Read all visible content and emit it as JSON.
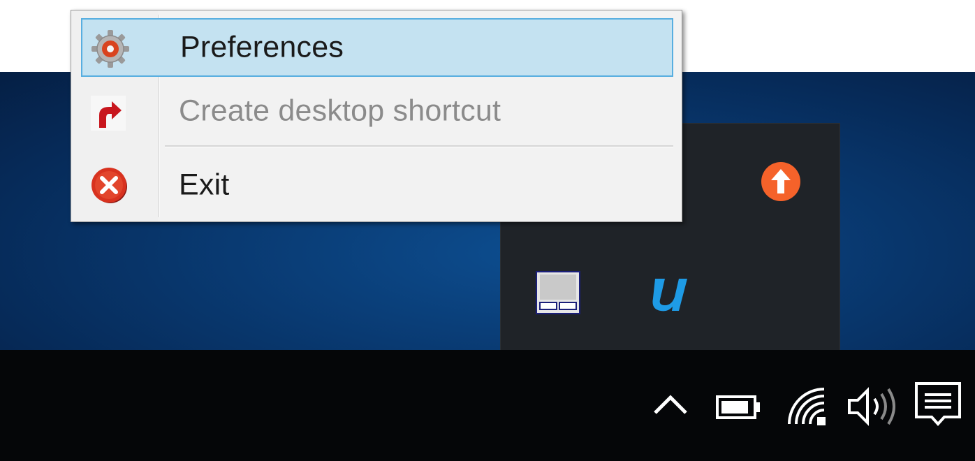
{
  "context_menu": {
    "items": [
      {
        "label": "Preferences",
        "icon": "gear-icon",
        "state": "highlighted"
      },
      {
        "label": "Create desktop shortcut",
        "icon": "shortcut-arrow-icon",
        "state": "disabled"
      },
      {
        "label": "Exit",
        "icon": "exit-icon",
        "state": "normal"
      }
    ]
  },
  "tray_overflow": {
    "icons": [
      "upload-arrow-icon",
      "touchpad-icon",
      "u-app-icon"
    ]
  },
  "taskbar": {
    "icons": [
      "show-hidden-icons-chevron-icon",
      "battery-icon",
      "wifi-icon",
      "volume-icon",
      "action-center-icon"
    ]
  },
  "colors": {
    "menu_highlight": "#c4e2f1",
    "menu_highlight_border": "#57aee0",
    "disabled_text": "#8b8b8b",
    "desktop_blue": "#093a72",
    "taskbar": "#050608",
    "tray_overflow": "#1f2328",
    "upload_orange": "#f5622a",
    "u_app_blue": "#1e9be6"
  }
}
